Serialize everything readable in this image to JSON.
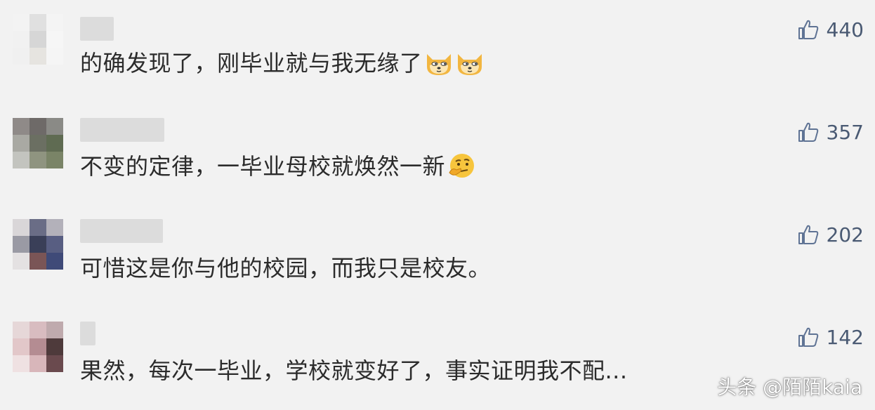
{
  "comments": [
    {
      "text": "的确发现了，刚毕业就与我无缘了",
      "likes": "440",
      "emojis": [
        "doge-emoji",
        "doge-emoji"
      ]
    },
    {
      "text": "不变的定律，一毕业母校就焕然一新",
      "likes": "357",
      "emojis": [
        "thinking-emoji"
      ]
    },
    {
      "text": "可惜这是你与他的校园，而我只是校友。",
      "likes": "202",
      "emojis": []
    },
    {
      "text": "果然，每次一毕业，学校就变好了，事实证明我不配...",
      "likes": "142",
      "emojis": []
    }
  ],
  "like_icon": "thumbs-up-icon",
  "watermark": "头条 @陌陌kaia",
  "colors": {
    "background": "#f2f2f2",
    "text": "#2b2b2b",
    "like_count": "#4a5a73",
    "like_icon": "#5f7394"
  }
}
